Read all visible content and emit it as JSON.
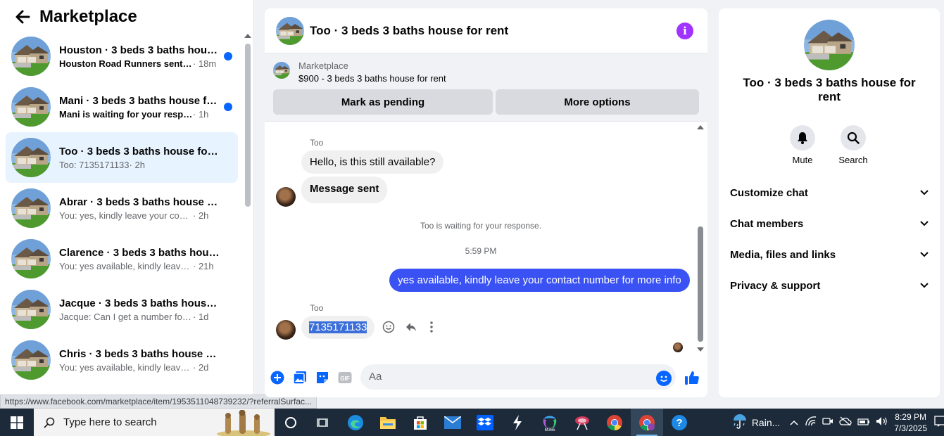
{
  "sidebar": {
    "title": "Marketplace",
    "conversations": [
      {
        "title": "Houston · 3 beds 3 baths hous...",
        "snippet": "Houston Road Runners sent y...",
        "time": " · 18m",
        "unread": true
      },
      {
        "title": "Mani · 3 beds 3 baths house fo...",
        "snippet": "Mani is waiting for your respon...",
        "time": " · 1h",
        "unread": true
      },
      {
        "title": "Too · 3 beds 3 baths house for r...",
        "snippet": "Too: 7135171133",
        "time": " · 2h",
        "unread": false,
        "active": true
      },
      {
        "title": "Abrar · 3 beds 3 baths house for...",
        "snippet": "You: yes, kindly leave your contact ...",
        "time": " · 2h",
        "unread": false
      },
      {
        "title": "Clarence · 3 beds 3 baths house ...",
        "snippet": "You: yes available, kindly leave yo...",
        "time": " · 21h",
        "unread": false
      },
      {
        "title": "Jacque · 3 beds 3 baths house fo...",
        "snippet": "Jacque: Can I get a number for you...",
        "time": " · 1d",
        "unread": false
      },
      {
        "title": "Chris · 3 beds 3 baths house for ...",
        "snippet": "You: yes available, kindly leave your...",
        "time": " · 2d",
        "unread": false
      }
    ]
  },
  "status_url": "https://www.facebook.com/marketplace/item/1953511048739232/?referralSurfac...",
  "chat": {
    "title": "Too · 3 beds 3 baths house for rent",
    "marketplace_label": "Marketplace",
    "listing": "$900 - 3 beds 3 baths house for rent",
    "mark_pending": "Mark as pending",
    "more_options": "More options",
    "sender1": "Too",
    "msg1": "Hello, is this still available?",
    "msg2": "Message sent",
    "waiting": "Too is waiting for your response.",
    "timestamp": "5:59 PM",
    "out_msg": "yes available, kindly leave your contact number for more info",
    "sender2": "Too",
    "msg3": "7135171133",
    "composer_placeholder": "Aa"
  },
  "info": {
    "title": "Too · 3 beds 3 baths house for rent",
    "mute": "Mute",
    "search": "Search",
    "sections": [
      "Customize chat",
      "Chat members",
      "Media, files and links",
      "Privacy & support"
    ]
  },
  "taskbar": {
    "search_placeholder": "Type here to search",
    "weather": "Rain...",
    "time": "8:29 PM",
    "date": "7/3/2025"
  }
}
